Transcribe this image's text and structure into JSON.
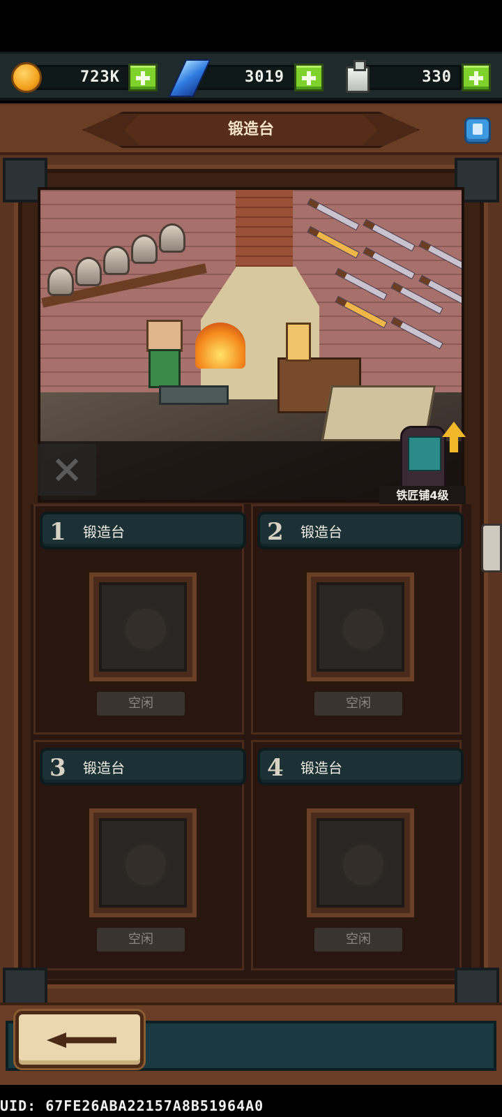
{
  "currency": {
    "gold": {
      "icon": "gold-coin-icon",
      "value": "723K"
    },
    "gem": {
      "icon": "blue-gem-icon",
      "value": "3019"
    },
    "potion": {
      "icon": "bottle-icon",
      "value": "330"
    }
  },
  "header": {
    "title": "锻造台",
    "info_icon": "info-book-icon"
  },
  "scene": {
    "building_label": "铁匠铺4级",
    "upgrade_icon": "upgrade-arrow-icon"
  },
  "slots": [
    {
      "number": "1",
      "title": "锻造台",
      "status": "空闲"
    },
    {
      "number": "2",
      "title": "锻造台",
      "status": "空闲"
    },
    {
      "number": "3",
      "title": "锻造台",
      "status": "空闲"
    },
    {
      "number": "4",
      "title": "锻造台",
      "status": "空闲"
    }
  ],
  "footer": {
    "back_icon": "back-arrow-icon",
    "uid": "UID: 67FE26ABA22157A8B51964A0"
  },
  "colors": {
    "wood": "#5b341f",
    "plus_green": "#7fd22b",
    "slot_header": "#1c3135",
    "upgrade_gold": "#f3b82a"
  }
}
